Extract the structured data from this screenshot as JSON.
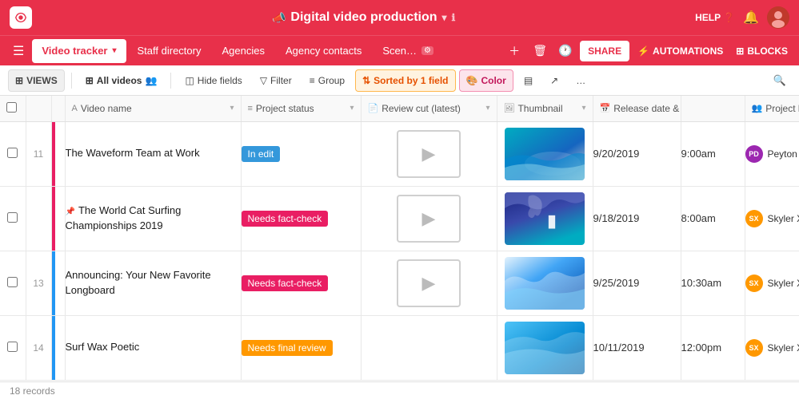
{
  "topbar": {
    "title": "Digital video production",
    "help_label": "HELP",
    "info_tooltip": "ℹ",
    "megaphone": "📣"
  },
  "navbar": {
    "tabs": [
      {
        "id": "video-tracker",
        "label": "Video tracker",
        "has_caret": true,
        "active": true
      },
      {
        "id": "staff-directory",
        "label": "Staff directory",
        "has_caret": false,
        "active": false
      },
      {
        "id": "agencies",
        "label": "Agencies",
        "has_caret": false,
        "active": false
      },
      {
        "id": "agency-contacts",
        "label": "Agency contacts",
        "has_caret": false,
        "active": false
      },
      {
        "id": "scenes",
        "label": "Scen…",
        "has_caret": false,
        "active": false
      }
    ],
    "share_label": "SHARE",
    "automations_label": "AUTOMATIONS",
    "blocks_label": "BLOCKS"
  },
  "toolbar": {
    "views_label": "VIEWS",
    "all_videos_label": "All videos",
    "hide_fields_label": "Hide fields",
    "filter_label": "Filter",
    "group_label": "Group",
    "sorted_label": "Sorted by 1 field",
    "color_label": "Color",
    "more_label": "…"
  },
  "table": {
    "columns": [
      {
        "id": "check",
        "label": ""
      },
      {
        "id": "num",
        "label": ""
      },
      {
        "id": "color",
        "label": ""
      },
      {
        "id": "name",
        "label": "Video name",
        "icon": "A",
        "type": "text"
      },
      {
        "id": "status",
        "label": "Project status",
        "icon": "≡",
        "type": "status"
      },
      {
        "id": "review",
        "label": "Review cut (latest)",
        "icon": "📄",
        "type": "attachment"
      },
      {
        "id": "thumbnail",
        "label": "Thumbnail",
        "icon": "🖼",
        "type": "attachment"
      },
      {
        "id": "release",
        "label": "Release date & time",
        "icon": "📅",
        "type": "date"
      },
      {
        "id": "lead",
        "label": "Project lead",
        "icon": "👥",
        "type": "people"
      }
    ],
    "rows": [
      {
        "id": 11,
        "color": "#e91e63",
        "name": "The Waveform Team at Work",
        "status": "In edit",
        "status_class": "in-edit",
        "has_video": true,
        "thumb_class": "thumb-1",
        "release_date": "9/20/2019",
        "release_time": "9:00am",
        "lead_name": "Peyton Deve…",
        "lead_color": "#9c27b0",
        "lead_initials": "PD",
        "pinned": false
      },
      {
        "id": null,
        "color": "#e91e63",
        "name": "The World Cat Surfing Championships 2019",
        "status": "Needs fact-check",
        "status_class": "needs-fact",
        "has_video": true,
        "thumb_class": "thumb-2",
        "release_date": "9/18/2019",
        "release_time": "8:00am",
        "lead_name": "Skyler Xu",
        "lead_color": "#ff9800",
        "lead_initials": "SX",
        "pinned": true
      },
      {
        "id": 13,
        "color": "#2196f3",
        "name": "Announcing: Your New Favorite Longboard",
        "status": "Needs fact-check",
        "status_class": "needs-fact",
        "has_video": true,
        "thumb_class": "thumb-3",
        "release_date": "9/25/2019",
        "release_time": "10:30am",
        "lead_name": "Skyler Xu",
        "lead_color": "#ff9800",
        "lead_initials": "SX",
        "pinned": false
      },
      {
        "id": 14,
        "color": "#2196f3",
        "name": "Surf Wax Poetic",
        "status": "Needs final review",
        "status_class": "needs-final",
        "has_video": false,
        "thumb_class": "thumb-4",
        "release_date": "10/11/2019",
        "release_time": "12:00pm",
        "lead_name": "Skyler Xu",
        "lead_color": "#ff9800",
        "lead_initials": "SX",
        "pinned": false
      }
    ],
    "record_count": "18 records"
  }
}
